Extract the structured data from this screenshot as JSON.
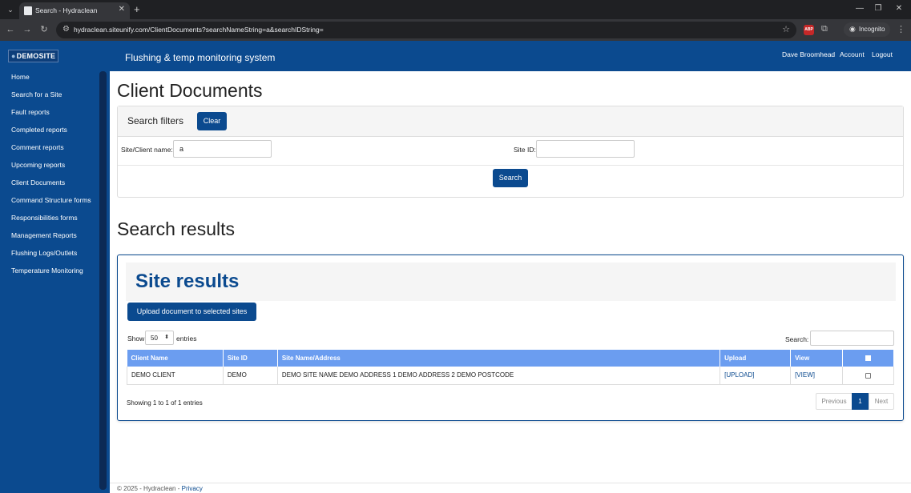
{
  "browser": {
    "tab_title": "Search - Hydraclean",
    "url": "hydraclean.siteunify.com/ClientDocuments?searchNameString=a&searchIDString=",
    "incognito_label": "Incognito",
    "abp_label": "ABP"
  },
  "header": {
    "logo": "DEMOSITE",
    "app_title": "Flushing & temp monitoring system",
    "user_name": "Dave Broomhead",
    "account_label": "Account",
    "logout_label": "Logout",
    "color": "#0b4a8f"
  },
  "sidebar": {
    "items": [
      {
        "label": "Home"
      },
      {
        "label": "Search for a Site"
      },
      {
        "label": "Fault reports"
      },
      {
        "label": "Completed reports"
      },
      {
        "label": "Comment reports"
      },
      {
        "label": "Upcoming reports"
      },
      {
        "label": "Client Documents"
      },
      {
        "label": "Command Structure forms"
      },
      {
        "label": "Responsibilities forms"
      },
      {
        "label": "Management Reports"
      },
      {
        "label": "Flushing Logs/Outlets"
      },
      {
        "label": "Temperature Monitoring"
      }
    ]
  },
  "main": {
    "page_title": "Client Documents",
    "filters": {
      "title": "Search filters",
      "clear_label": "Clear",
      "name_label": "Site/Client name:",
      "name_value": "a",
      "id_label": "Site ID:",
      "id_value": "",
      "search_label": "Search"
    },
    "results_title": "Search results",
    "site_results": {
      "title": "Site results",
      "upload_button": "Upload document to selected sites",
      "show_label": "Show",
      "entries_value": "50",
      "entries_label": "entries",
      "search_label": "Search:",
      "columns": [
        "Client Name",
        "Site ID",
        "Site Name/Address",
        "Upload",
        "View"
      ],
      "rows": [
        {
          "client_name": "DEMO CLIENT",
          "site_id": "DEMO",
          "site_address": "DEMO SITE NAME DEMO ADDRESS 1 DEMO ADDRESS 2 DEMO POSTCODE",
          "upload": "[UPLOAD]",
          "view": "[VIEW]"
        }
      ],
      "showing_text": "Showing 1 to 1 of 1 entries",
      "pager": {
        "previous": "Previous",
        "current": "1",
        "next": "Next"
      }
    }
  },
  "footer": {
    "text": "© 2025 - Hydraclean - ",
    "privacy_label": "Privacy"
  }
}
